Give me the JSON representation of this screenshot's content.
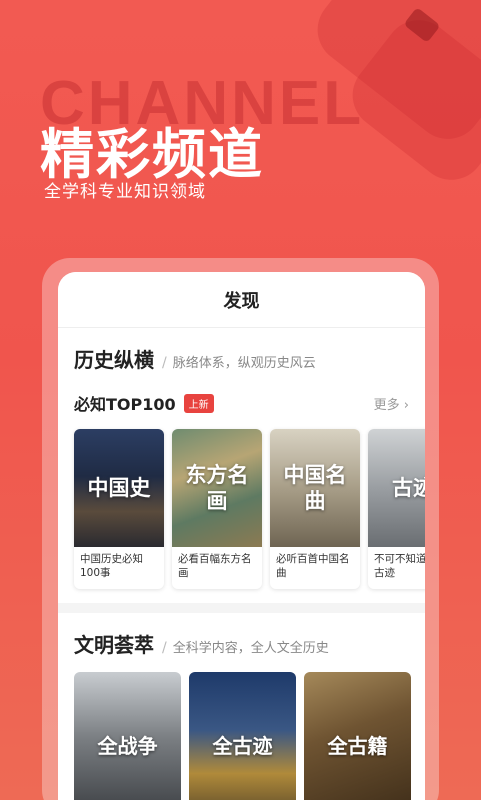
{
  "hero": {
    "bg_word": "CHANNEL",
    "title": "精彩频道",
    "subtitle": "全学科专业知识领域"
  },
  "app": {
    "nav_title": "发现",
    "history": {
      "title": "历史纵横",
      "divider": "/",
      "subtitle": "脉络体系，纵观历史风云",
      "sub_title": "必知TOP100",
      "badge": "上新",
      "more": "更多 ›",
      "cards": [
        {
          "image_text": "中国史",
          "caption": "中国历史必知100事"
        },
        {
          "image_text": "东方名画",
          "caption": "必看百幅东方名画"
        },
        {
          "image_text": "中国名曲",
          "caption": "必听百首中国名曲"
        },
        {
          "image_text": "古迹",
          "caption": "不可不知道百大古迹"
        }
      ]
    },
    "civilization": {
      "title": "文明荟萃",
      "divider": "/",
      "subtitle": "全科学内容，全人文全历史",
      "cards": [
        {
          "image_text": "全战争"
        },
        {
          "image_text": "全古迹"
        },
        {
          "image_text": "全古籍"
        }
      ]
    }
  },
  "colors": {
    "background": "#f25a52",
    "badge": "#e8433f"
  }
}
